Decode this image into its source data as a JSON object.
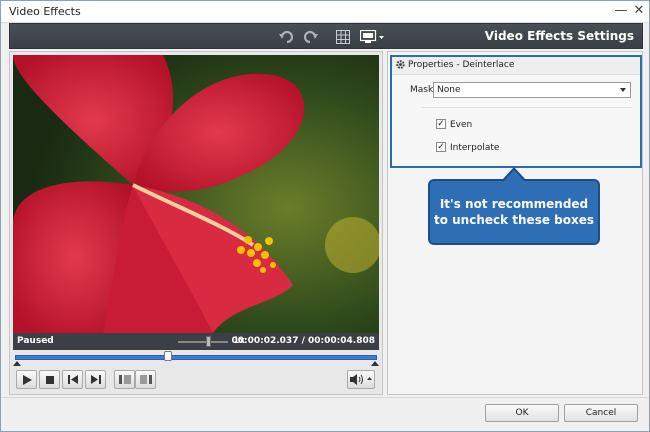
{
  "window": {
    "title": "Video Effects"
  },
  "toolbar": {
    "settings_title": "Video Effects Settings"
  },
  "player": {
    "status": "Paused",
    "speed": "1x",
    "time": "00:00:02.037 / 00:00:04.808",
    "progress": 0.42,
    "speed_level": 0.6
  },
  "properties": {
    "title": "Properties - Deinterlace",
    "mask_label": "Mask:",
    "mask_value": "None",
    "checkboxes": [
      {
        "label": "Even",
        "checked": true
      },
      {
        "label": "Interpolate",
        "checked": true
      }
    ]
  },
  "callout": {
    "line1": "It's not recommended",
    "line2": "to uncheck these boxes"
  },
  "footer": {
    "ok_label": "OK",
    "cancel_label": "Cancel"
  },
  "colors": {
    "accent": "#2e6eb5",
    "toolbar": "#3a3e45",
    "timeline": "#3d7bd8"
  }
}
